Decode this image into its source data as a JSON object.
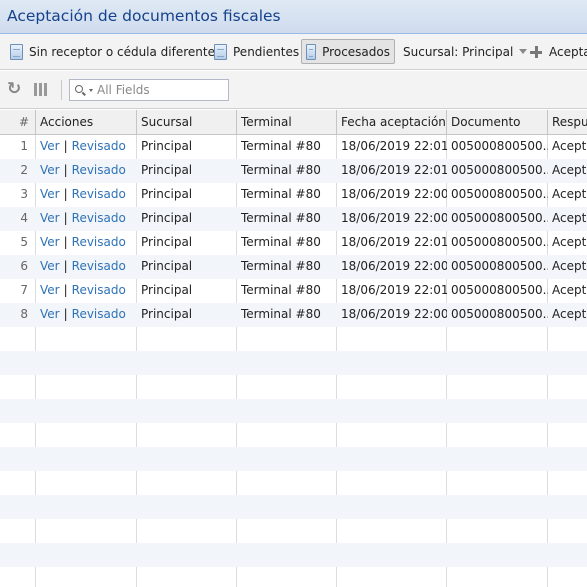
{
  "window": {
    "title": "Aceptación de documentos fiscales"
  },
  "toolbar": {
    "btn_sin_receptor": "Sin receptor o cédula diferente",
    "btn_pendientes": "Pendientes",
    "btn_procesados": "Procesados",
    "sucursal_label": "Sucursal: Principal",
    "btn_aceptar": "Aceptar"
  },
  "search": {
    "placeholder": "All Fields"
  },
  "columns": [
    "#",
    "Acciones",
    "Sucursal",
    "Terminal",
    "Fecha aceptación",
    "Documento",
    "Respuesta"
  ],
  "rows": [
    {
      "n": "1",
      "ver": "Ver",
      "revisado": "Revisado",
      "sucursal": "Principal",
      "terminal": "Terminal #80",
      "fecha": "18/06/2019 22:01",
      "documento": "005000800500...",
      "respuesta": "Aceptado"
    },
    {
      "n": "2",
      "ver": "Ver",
      "revisado": "Revisado",
      "sucursal": "Principal",
      "terminal": "Terminal #80",
      "fecha": "18/06/2019 22:01",
      "documento": "005000800500...",
      "respuesta": "Aceptado"
    },
    {
      "n": "3",
      "ver": "Ver",
      "revisado": "Revisado",
      "sucursal": "Principal",
      "terminal": "Terminal #80",
      "fecha": "18/06/2019 22:00",
      "documento": "005000800500...",
      "respuesta": "Aceptado"
    },
    {
      "n": "4",
      "ver": "Ver",
      "revisado": "Revisado",
      "sucursal": "Principal",
      "terminal": "Terminal #80",
      "fecha": "18/06/2019 22:00",
      "documento": "005000800500...",
      "respuesta": "Aceptado"
    },
    {
      "n": "5",
      "ver": "Ver",
      "revisado": "Revisado",
      "sucursal": "Principal",
      "terminal": "Terminal #80",
      "fecha": "18/06/2019 22:01",
      "documento": "005000800500...",
      "respuesta": "Aceptado"
    },
    {
      "n": "6",
      "ver": "Ver",
      "revisado": "Revisado",
      "sucursal": "Principal",
      "terminal": "Terminal #80",
      "fecha": "18/06/2019 22:00",
      "documento": "005000800500...",
      "respuesta": "Aceptado"
    },
    {
      "n": "7",
      "ver": "Ver",
      "revisado": "Revisado",
      "sucursal": "Principal",
      "terminal": "Terminal #80",
      "fecha": "18/06/2019 22:01",
      "documento": "005000800500...",
      "respuesta": "Aceptado"
    },
    {
      "n": "8",
      "ver": "Ver",
      "revisado": "Revisado",
      "sucursal": "Principal",
      "terminal": "Terminal #80",
      "fecha": "18/06/2019 22:00",
      "documento": "005000800500...",
      "respuesta": "Aceptado"
    }
  ]
}
